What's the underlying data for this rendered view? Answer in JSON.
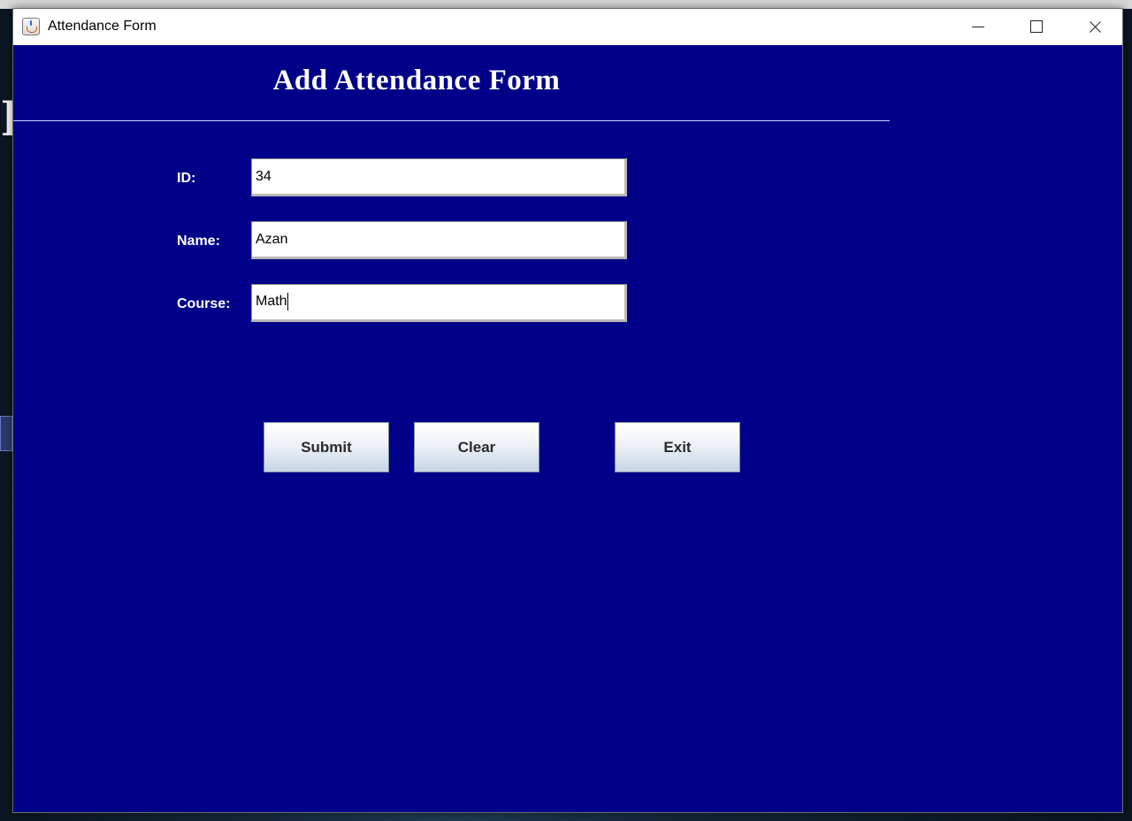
{
  "window": {
    "title": "Attendance Form"
  },
  "background": {
    "partial_char": "]"
  },
  "form": {
    "heading": "Add Attendance Form",
    "fields": [
      {
        "label": "ID:",
        "value": "34"
      },
      {
        "label": "Name:",
        "value": "Azan"
      },
      {
        "label": "Course:",
        "value": "Math"
      }
    ],
    "buttons": {
      "submit": "Submit",
      "clear": "Clear",
      "exit": "Exit"
    }
  },
  "colors": {
    "form_background": "#000088",
    "text": "#ffffff",
    "button_text": "#2a2a2a"
  },
  "icons": {
    "app": "java-cup-icon",
    "minimize": "minimize-icon",
    "maximize": "maximize-icon",
    "close": "close-icon"
  }
}
